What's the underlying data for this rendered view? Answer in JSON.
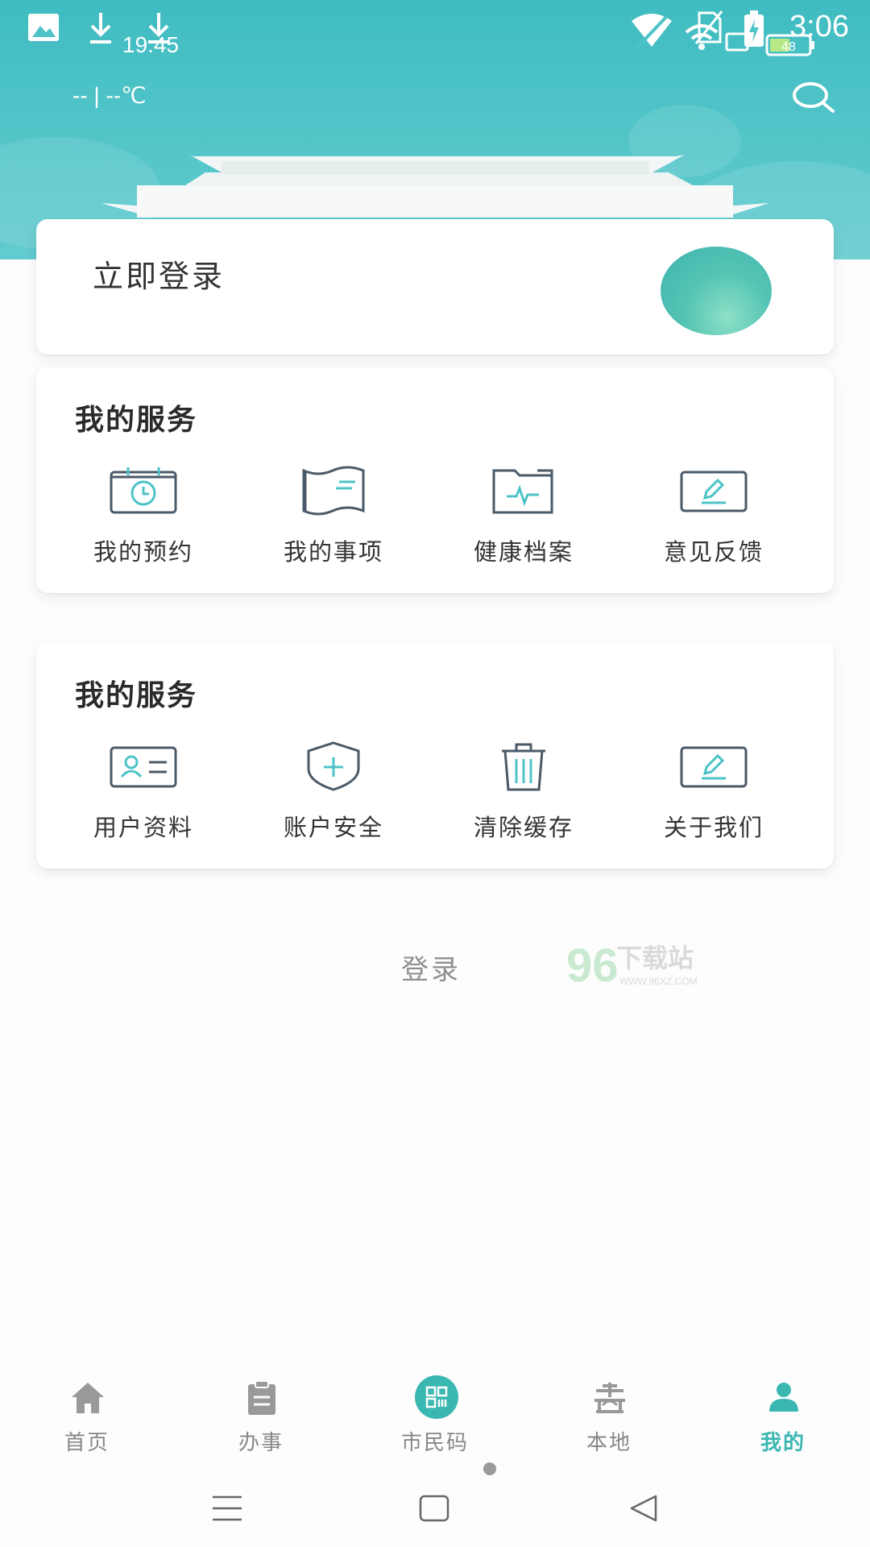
{
  "status_bar": {
    "download_time": "19:45",
    "clock": "3:06",
    "battery": "48"
  },
  "header": {
    "weather": "--  |  --℃",
    "search_icon": "search-icon"
  },
  "login_card": {
    "title": "立即登录",
    "avatar_icon": "avatar-placeholder"
  },
  "services": [
    {
      "title": "我的服务",
      "items": [
        {
          "label": "我的预约",
          "icon": "calendar-clock-icon"
        },
        {
          "label": "我的事项",
          "icon": "book-icon"
        },
        {
          "label": "健康档案",
          "icon": "health-folder-icon"
        },
        {
          "label": "意见反馈",
          "icon": "feedback-edit-icon"
        }
      ]
    },
    {
      "title": "我的服务",
      "items": [
        {
          "label": "用户资料",
          "icon": "id-card-icon"
        },
        {
          "label": "账户安全",
          "icon": "shield-plus-icon"
        },
        {
          "label": "清除缓存",
          "icon": "trash-icon"
        },
        {
          "label": "关于我们",
          "icon": "about-edit-icon"
        }
      ]
    }
  ],
  "login_link": "登录",
  "watermark": {
    "digits": "96",
    "text": "下载站",
    "url": "WWW.96XZ.COM"
  },
  "tab_bar": {
    "items": [
      {
        "label": "首页",
        "icon": "home-icon",
        "active": false
      },
      {
        "label": "办事",
        "icon": "clipboard-icon",
        "active": false
      },
      {
        "label": "市民码",
        "icon": "qr-code-icon",
        "active": false
      },
      {
        "label": "本地",
        "icon": "local-landmark-icon",
        "active": false
      },
      {
        "label": "我的",
        "icon": "person-icon",
        "active": true
      }
    ]
  },
  "colors": {
    "header": "#4ec3c7",
    "accent": "#3bb7b2",
    "icon_dark": "#4a5a68"
  }
}
